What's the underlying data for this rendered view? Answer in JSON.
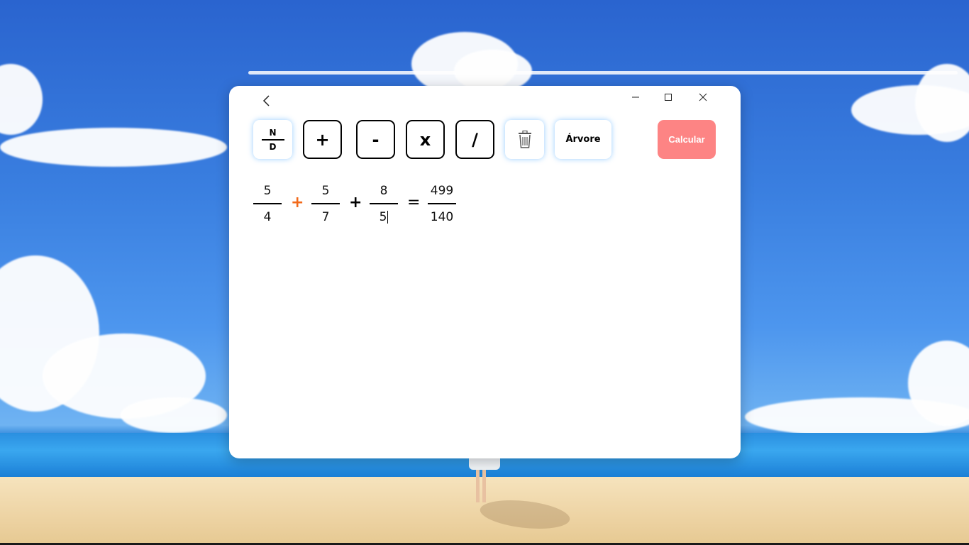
{
  "titlebar": {
    "back_icon": "chevron-left-icon",
    "minimize_icon": "minimize-icon",
    "maximize_icon": "maximize-icon",
    "close_icon": "close-icon"
  },
  "toolbar": {
    "fraction_button": {
      "numerator_label": "N",
      "denominator_label": "D"
    },
    "plus_label": "+",
    "minus_label": "-",
    "multiply_label": "x",
    "divide_label": "/",
    "delete_icon": "trash-icon",
    "tree_label": "Árvore",
    "calculate_label": "Calcular"
  },
  "expression": {
    "terms": [
      {
        "numerator": "5",
        "denominator": "4"
      },
      {
        "numerator": "5",
        "denominator": "7"
      },
      {
        "numerator": "8",
        "denominator": "5"
      }
    ],
    "operators": [
      "+",
      "+"
    ],
    "equals": "=",
    "result": {
      "numerator": "499",
      "denominator": "140"
    }
  },
  "colors": {
    "selected_operator": "#f26a1b",
    "calculate_button": "#fd8484",
    "button_glow": "#78beff"
  }
}
